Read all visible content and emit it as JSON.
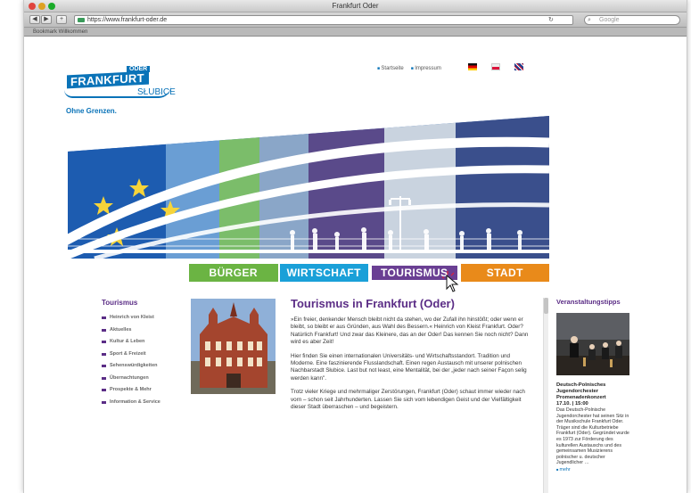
{
  "browser": {
    "window_title": "Frankfurt Oder",
    "url": "https://www.frankfurt-oder.de",
    "search_placeholder": "Google",
    "tab_label": "Bookmark Willkommen"
  },
  "logo": {
    "oder": "ODER",
    "frankfurt": "FRANKFURT",
    "slubice": "SŁUBICE",
    "tagline": "Ohne Grenzen."
  },
  "toplinks": [
    "Startseite",
    "Impressum"
  ],
  "mainnav": [
    "BÜRGER",
    "WIRTSCHAFT",
    "TOURISMUS",
    "STADT"
  ],
  "sidebar": {
    "title": "Tourismus",
    "items": [
      "Heinrich von Kleist",
      "Aktuelles",
      "Kultur & Leben",
      "Sport & Freizeit",
      "Sehenswürdigkeiten",
      "Übernachtungen",
      "Prospekte & Mehr",
      "Information & Service"
    ]
  },
  "content": {
    "heading": "Tourismus in Frankfurt (Oder)",
    "paragraphs": [
      "»Ein freier, denkender Mensch bleibt nicht da stehen, wo der Zufall ihn hinstößt; oder wenn er bleibt, so bleibt er aus Gründen, aus Wahl des Bessern.« Heinrich von Kleist Frankfurt. Oder? Natürlich Frankfurt! Und zwar das Kleinere, das an der Oder! Das kennen Sie noch nicht? Dann wird es aber Zeit!",
      "Hier finden Sie einen internationalen Universitäts- und Wirtschaftsstandort. Tradition und Moderne. Eine faszinierende Flusslandschaft. Einen regen Austausch mit unserer polnischen Nachbarstadt Słubice. Last but not least, eine Mentalität, bei der „jeder nach seiner Façon selig werden kann\".",
      "Trotz vieler Kriege und mehrmaliger Zerstörungen, Frankfurt (Oder) schaut immer wieder nach vorn – schon seit Jahrhunderten. Lassen Sie sich vom lebendigen Geist und der Vielfältigkeit dieser Stadt überraschen – und begeistern."
    ]
  },
  "events": {
    "title": "Veranstaltungstipps",
    "event_title": "Deutsch-Polnisches Jugendorchester Promenadenkonzert",
    "event_date": "17.10. | 15:00",
    "event_text": "Das Deutsch-Polnische Jugendorchester hat seinen Sitz in der Musikschule Frankfurt Oder. Träger sind die Kulturbetriebe Frankfurt (Oder). Gegründet wurde es 1973 zur Förderung des kulturellen Austauschs und des gemeinsamen Musizierens polnischer u. deutscher Jugendlicher …",
    "more": "mehr"
  },
  "colors": {
    "brand_blue": "#0a73b8",
    "purple": "#5b2d86",
    "nav_green": "#6bb443",
    "nav_cyan": "#1aa0d8",
    "nav_purple": "#6a3f93",
    "nav_orange": "#e98a1a"
  }
}
